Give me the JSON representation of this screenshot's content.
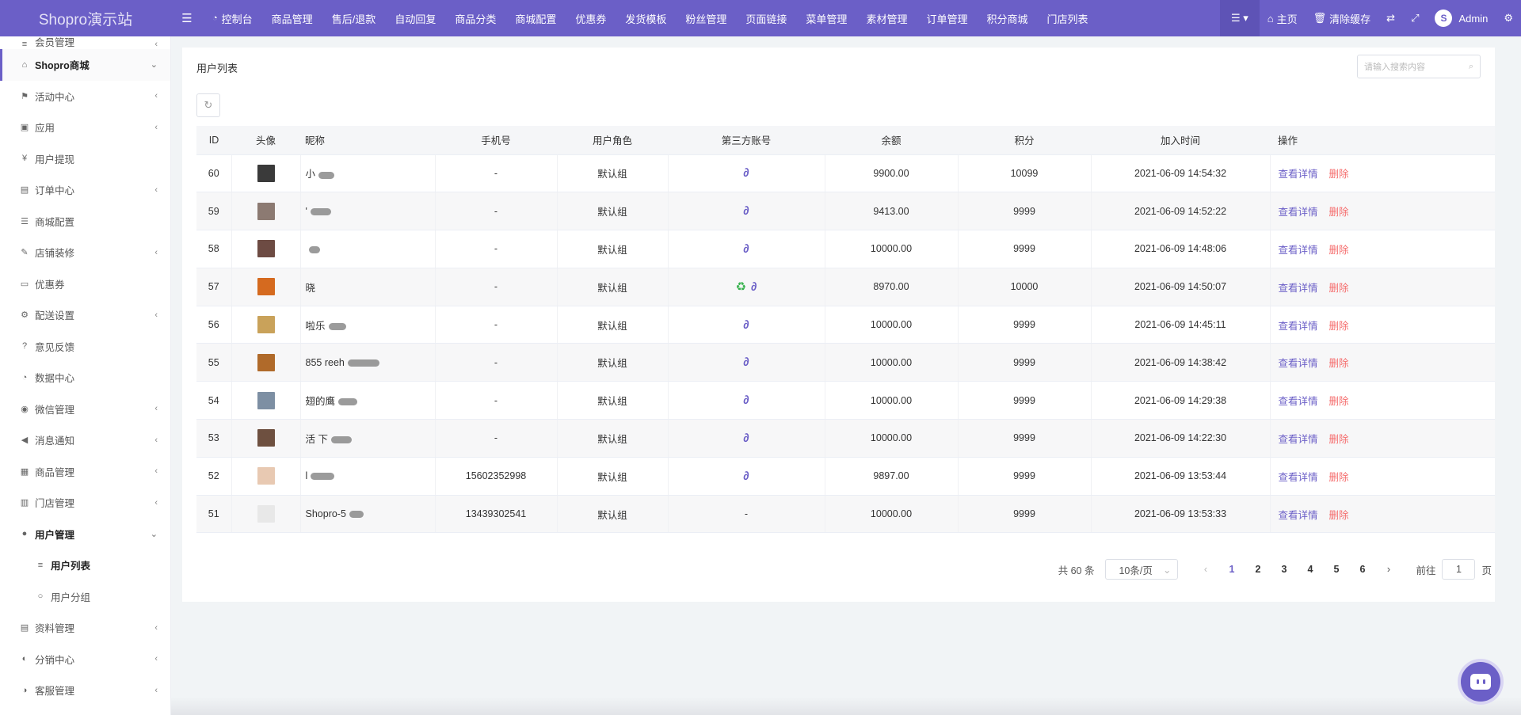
{
  "app": {
    "title": "Shopro演示站"
  },
  "topnav": [
    {
      "label": "控制台",
      "icon": "dashboard-icon"
    },
    {
      "label": "商品管理"
    },
    {
      "label": "售后/退款"
    },
    {
      "label": "自动回复"
    },
    {
      "label": "商品分类"
    },
    {
      "label": "商城配置"
    },
    {
      "label": "优惠券"
    },
    {
      "label": "发货模板"
    },
    {
      "label": "粉丝管理"
    },
    {
      "label": "页面链接"
    },
    {
      "label": "菜单管理"
    },
    {
      "label": "素材管理"
    },
    {
      "label": "订单管理"
    },
    {
      "label": "积分商城"
    },
    {
      "label": "门店列表"
    }
  ],
  "topright": {
    "home": "主页",
    "clear_cache": "清除缓存",
    "user": "Admin"
  },
  "sidebar": {
    "partial_top": "会员管理",
    "items": [
      {
        "label": "Shopro商城",
        "icon": "home-icon",
        "arrow": "⌄"
      },
      {
        "label": "活动中心",
        "icon": "flag-icon",
        "arrow": "‹"
      },
      {
        "label": "应用",
        "icon": "briefcase-icon",
        "arrow": "‹"
      },
      {
        "label": "用户提现",
        "icon": "yen-icon",
        "arrow": ""
      },
      {
        "label": "订单中心",
        "icon": "file-icon",
        "arrow": "‹"
      },
      {
        "label": "商城配置",
        "icon": "sliders-icon",
        "arrow": ""
      },
      {
        "label": "店铺装修",
        "icon": "brush-icon",
        "arrow": "‹"
      },
      {
        "label": "优惠券",
        "icon": "money-icon",
        "arrow": ""
      },
      {
        "label": "配送设置",
        "icon": "cogs-icon",
        "arrow": "‹"
      },
      {
        "label": "意见反馈",
        "icon": "question-icon",
        "arrow": ""
      },
      {
        "label": "数据中心",
        "icon": "dashboard-icon",
        "arrow": ""
      },
      {
        "label": "微信管理",
        "icon": "wechat-icon",
        "arrow": "‹"
      },
      {
        "label": "消息通知",
        "icon": "bullhorn-icon",
        "arrow": "‹"
      },
      {
        "label": "商品管理",
        "icon": "shop-icon",
        "arrow": "‹"
      },
      {
        "label": "门店管理",
        "icon": "bank-icon",
        "arrow": "‹"
      },
      {
        "label": "用户管理",
        "icon": "user-icon",
        "arrow": "⌄"
      }
    ],
    "subitems": [
      {
        "label": "用户列表",
        "icon": "list-icon"
      },
      {
        "label": "用户分组",
        "icon": "circle-icon"
      }
    ],
    "items_after": [
      {
        "label": "资料管理",
        "icon": "file-icon",
        "arrow": "‹"
      },
      {
        "label": "分销中心",
        "icon": "users-icon",
        "arrow": "‹"
      },
      {
        "label": "客服管理",
        "icon": "headset-icon",
        "arrow": "‹"
      }
    ]
  },
  "page": {
    "title": "用户列表",
    "search_placeholder": "请输入搜索内容"
  },
  "table": {
    "headers": [
      "ID",
      "头像",
      "昵称",
      "手机号",
      "用户角色",
      "第三方账号",
      "余额",
      "积分",
      "加入时间",
      "操作"
    ],
    "view_label": "查看详情",
    "delete_label": "删除",
    "rows": [
      {
        "id": "60",
        "nick": "小",
        "phone": "-",
        "role": "默认组",
        "third": [
          "link"
        ],
        "balance": "9900.00",
        "points": "10099",
        "time": "2021-06-09 14:54:32"
      },
      {
        "id": "59",
        "nick": "'",
        "phone": "-",
        "role": "默认组",
        "third": [
          "link"
        ],
        "balance": "9413.00",
        "points": "9999",
        "time": "2021-06-09 14:52:22"
      },
      {
        "id": "58",
        "nick": "",
        "phone": "-",
        "role": "默认组",
        "third": [
          "link"
        ],
        "balance": "10000.00",
        "points": "9999",
        "time": "2021-06-09 14:48:06"
      },
      {
        "id": "57",
        "nick": "晓",
        "phone": "-",
        "role": "默认组",
        "third": [
          "wechat",
          "link"
        ],
        "balance": "8970.00",
        "points": "10000",
        "time": "2021-06-09 14:50:07"
      },
      {
        "id": "56",
        "nick": "啦乐",
        "phone": "-",
        "role": "默认组",
        "third": [
          "link"
        ],
        "balance": "10000.00",
        "points": "9999",
        "time": "2021-06-09 14:45:11"
      },
      {
        "id": "55",
        "nick": "855 reeh",
        "phone": "-",
        "role": "默认组",
        "third": [
          "link"
        ],
        "balance": "10000.00",
        "points": "9999",
        "time": "2021-06-09 14:38:42"
      },
      {
        "id": "54",
        "nick": "翅的鹰",
        "phone": "-",
        "role": "默认组",
        "third": [
          "link"
        ],
        "balance": "10000.00",
        "points": "9999",
        "time": "2021-06-09 14:29:38"
      },
      {
        "id": "53",
        "nick": "活 下",
        "phone": "-",
        "role": "默认组",
        "third": [
          "link"
        ],
        "balance": "10000.00",
        "points": "9999",
        "time": "2021-06-09 14:22:30"
      },
      {
        "id": "52",
        "nick": "l",
        "phone": "15602352998",
        "role": "默认组",
        "third": [
          "link"
        ],
        "balance": "9897.00",
        "points": "9999",
        "time": "2021-06-09 13:53:44"
      },
      {
        "id": "51",
        "nick": "Shopro-5",
        "phone": "13439302541",
        "role": "默认组",
        "third": [],
        "third_text": "-",
        "balance": "10000.00",
        "points": "9999",
        "time": "2021-06-09 13:53:33"
      }
    ]
  },
  "pagination": {
    "total": "共 60 条",
    "page_size": "10条/页",
    "pages": [
      "1",
      "2",
      "3",
      "4",
      "5",
      "6"
    ],
    "current": "1",
    "goto_prefix": "前往",
    "goto_value": "1",
    "goto_suffix": "页"
  },
  "colors": {
    "accent": "#6b5fc7",
    "danger": "#f56c6c",
    "wechat": "#37b24d"
  }
}
